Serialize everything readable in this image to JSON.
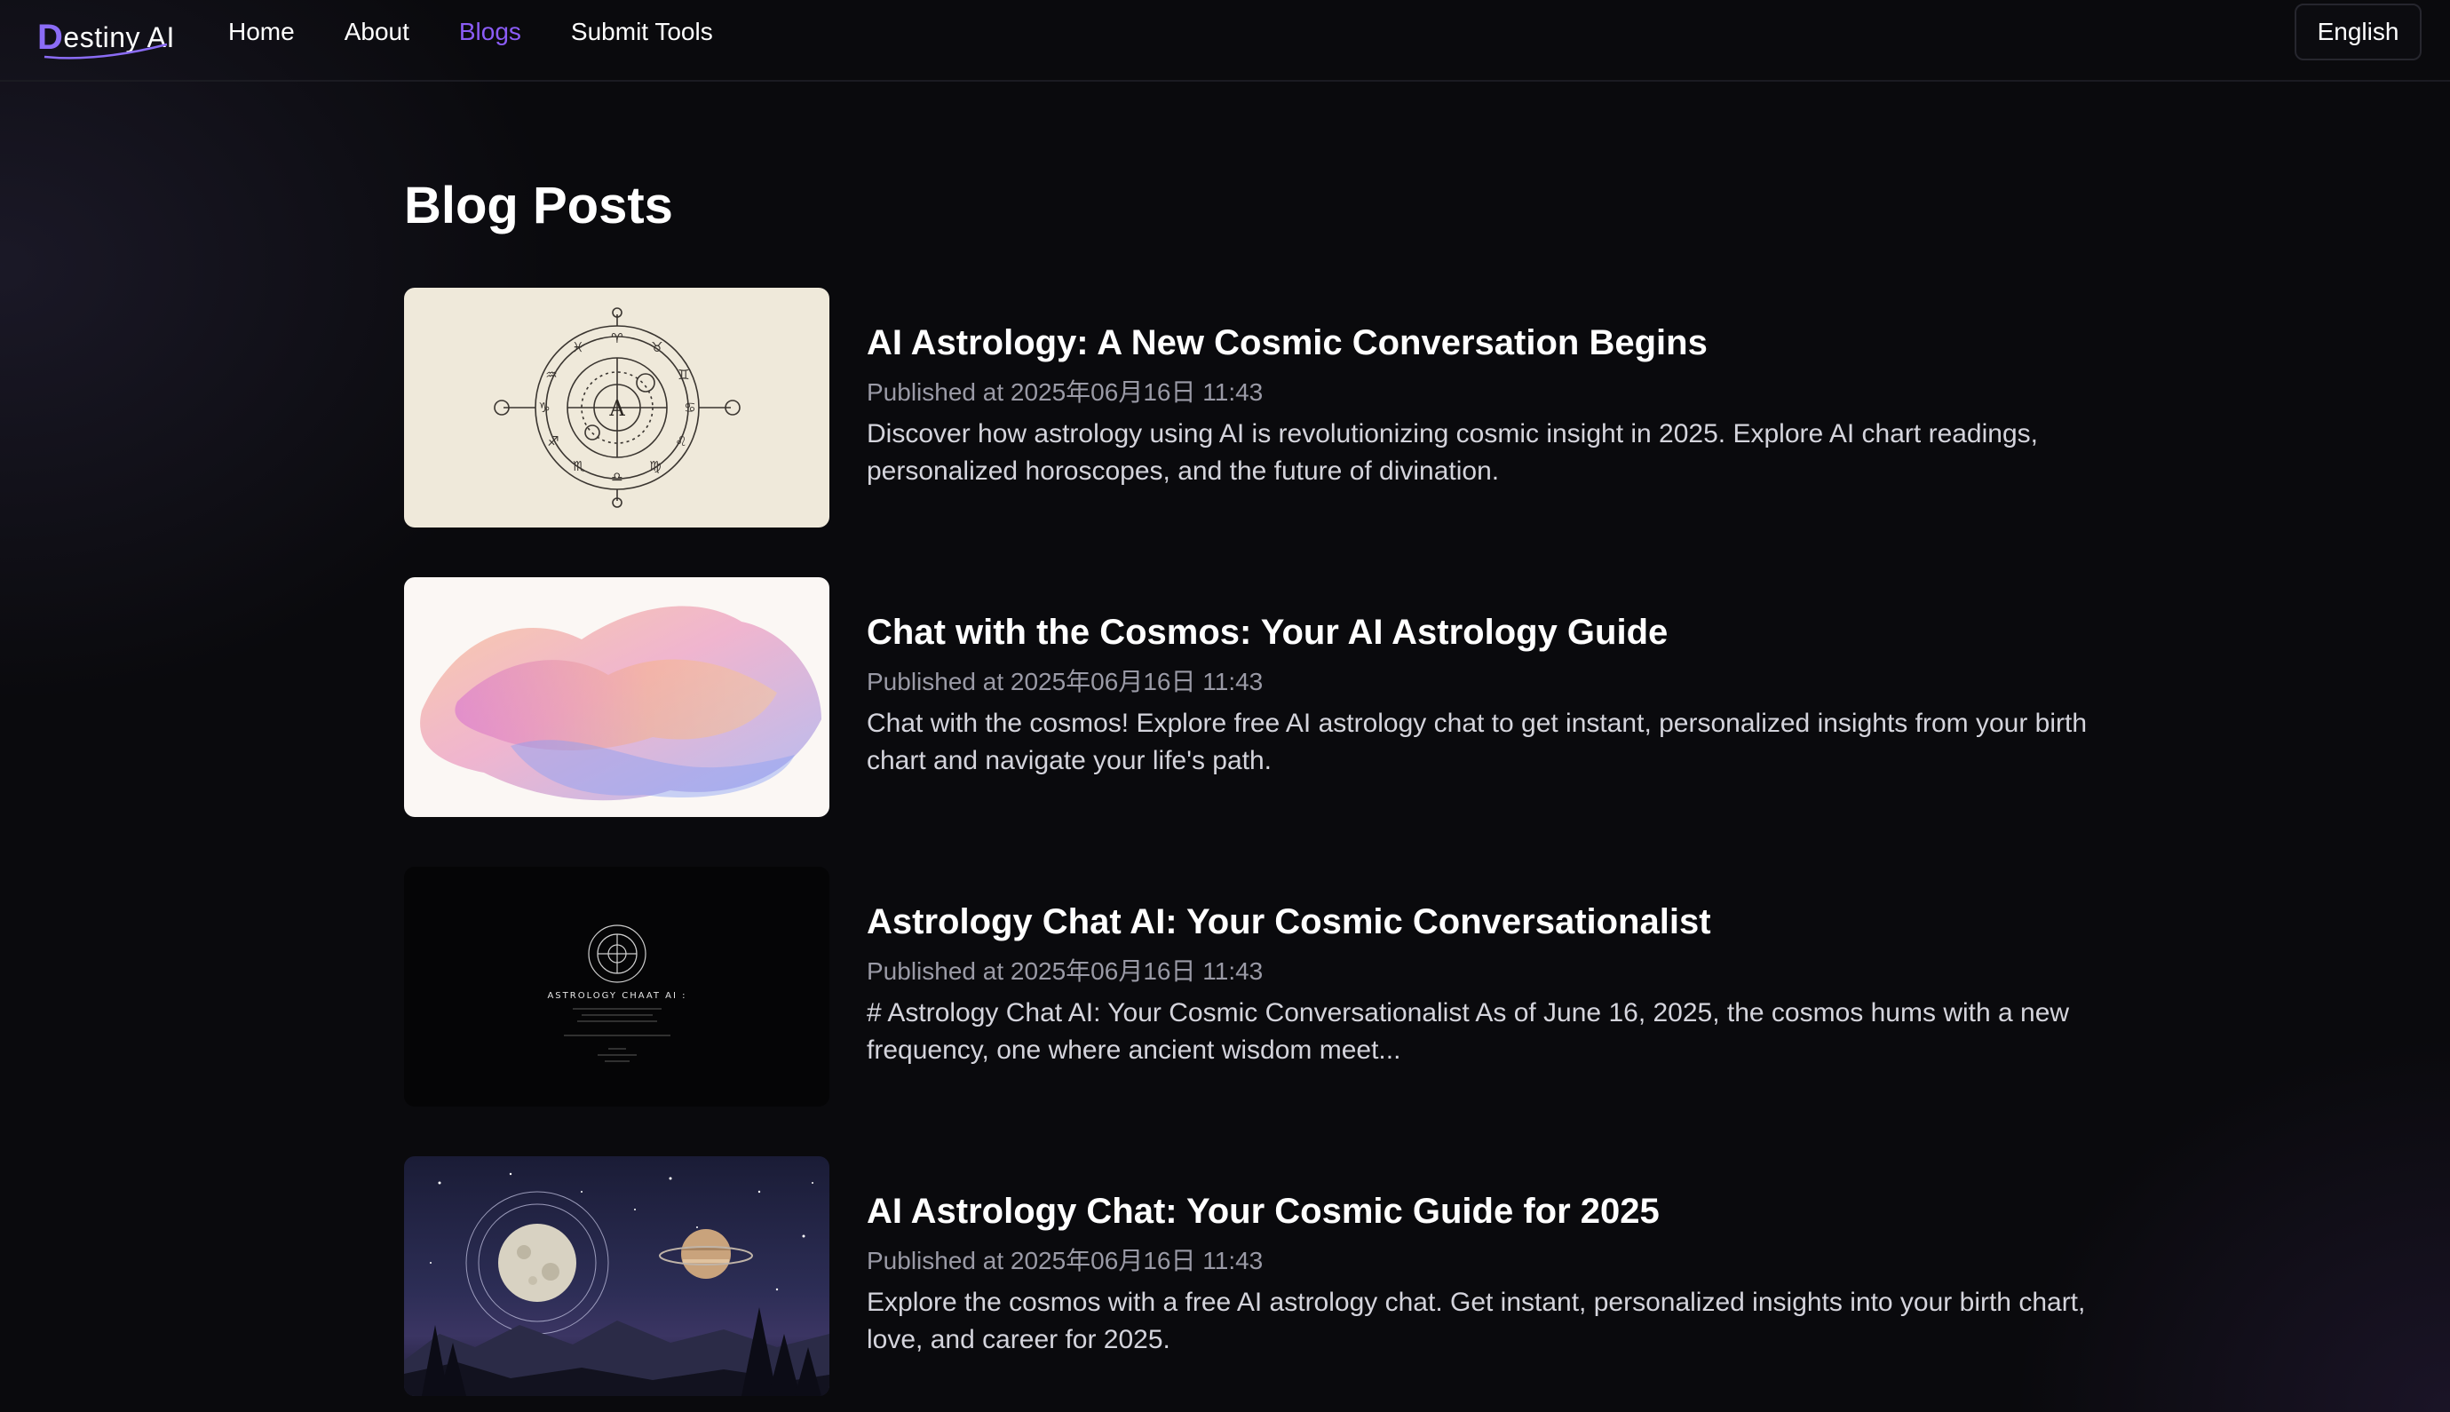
{
  "brand": {
    "initial": "D",
    "rest": "estiny AI"
  },
  "nav": [
    {
      "label": "Home",
      "active": false
    },
    {
      "label": "About",
      "active": false
    },
    {
      "label": "Blogs",
      "active": true
    },
    {
      "label": "Submit Tools",
      "active": false
    }
  ],
  "language": "English",
  "page_title": "Blog Posts",
  "posts": [
    {
      "title": "AI Astrology: A New Cosmic Conversation Begins",
      "date": "Published at 2025年06月16日 11:43",
      "description": "Discover how astrology using AI is revolutionizing cosmic insight in 2025. Explore AI chart readings, personalized horoscopes, and the future of divination.",
      "thumb_icon": "zodiac-wheel-icon",
      "thumb_letter": "A"
    },
    {
      "title": "Chat with the Cosmos: Your AI Astrology Guide",
      "date": "Published at 2025年06月16日 11:43",
      "description": "Chat with the cosmos! Explore free AI astrology chat to get instant, personalized insights from your birth chart and navigate your life's path.",
      "thumb_icon": "watercolor-image"
    },
    {
      "title": "Astrology Chat AI: Your Cosmic Conversationalist",
      "date": "Published at 2025年06月16日 11:43",
      "description": "# Astrology Chat AI: Your Cosmic Conversationalist As of June 16, 2025, the cosmos hums with a new frequency, one where ancient wisdom meet...",
      "thumb_icon": "astrology-chat-poster",
      "thumb_caption": "ASTROLOGY CHAAT AI :"
    },
    {
      "title": "AI Astrology Chat: Your Cosmic Guide for 2025",
      "date": "Published at 2025年06月16日 11:43",
      "description": "Explore the cosmos with a free AI astrology chat. Get instant, personalized insights into your birth chart, love, and career for 2025.",
      "thumb_icon": "moon-planet-night-sky-image"
    }
  ],
  "colors": {
    "accent": "#8b5cf6",
    "background": "#0a0a0d",
    "muted": "#9a9aa6"
  }
}
